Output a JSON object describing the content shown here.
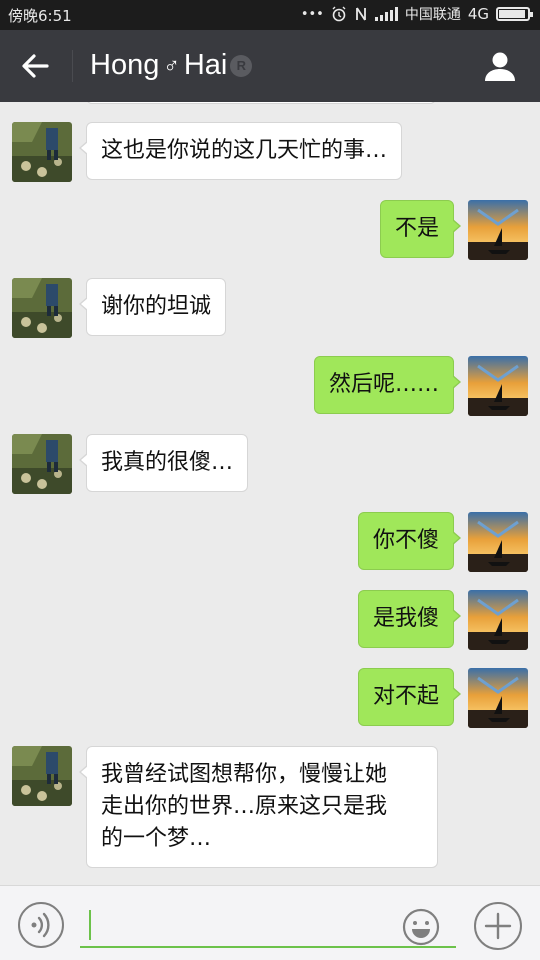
{
  "status_bar": {
    "time": "傍晚6:51",
    "carrier": "中国联通",
    "network": "4G",
    "icons": [
      "dots-icon",
      "alarm-icon",
      "nfc-icon",
      "signal-icon",
      "battery-icon"
    ]
  },
  "header": {
    "back_icon": "arrow-left-icon",
    "name_first": "Hong",
    "gender_glyph": "♂",
    "name_second": "Hai",
    "badge": "R",
    "profile_icon": "person-icon"
  },
  "messages": [
    {
      "side": "left",
      "text": "这也是你说的这几天忙的事…"
    },
    {
      "side": "right",
      "text": "不是"
    },
    {
      "side": "left",
      "text": "谢你的坦诚"
    },
    {
      "side": "right",
      "text": "然后呢……"
    },
    {
      "side": "left",
      "text": "我真的很傻…"
    },
    {
      "side": "right",
      "text": "你不傻"
    },
    {
      "side": "right",
      "text": "是我傻"
    },
    {
      "side": "right",
      "text": "对不起"
    },
    {
      "side": "left",
      "text_lines": [
        "我曾经试图想帮你，慢慢让她",
        "走出你的世界…原来这只是我",
        "的一个梦…"
      ]
    }
  ],
  "input_bar": {
    "value": "",
    "voice_icon": "voice-icon",
    "emoji_icon": "emoji-icon",
    "plus_icon": "plus-icon"
  },
  "colors": {
    "header_bg": "#393a3f",
    "status_bg": "#1c1c1c",
    "chat_bg": "#ebebeb",
    "sent_bubble": "#a0e75a",
    "received_bubble": "#ffffff",
    "accent": "#6cc24a"
  }
}
